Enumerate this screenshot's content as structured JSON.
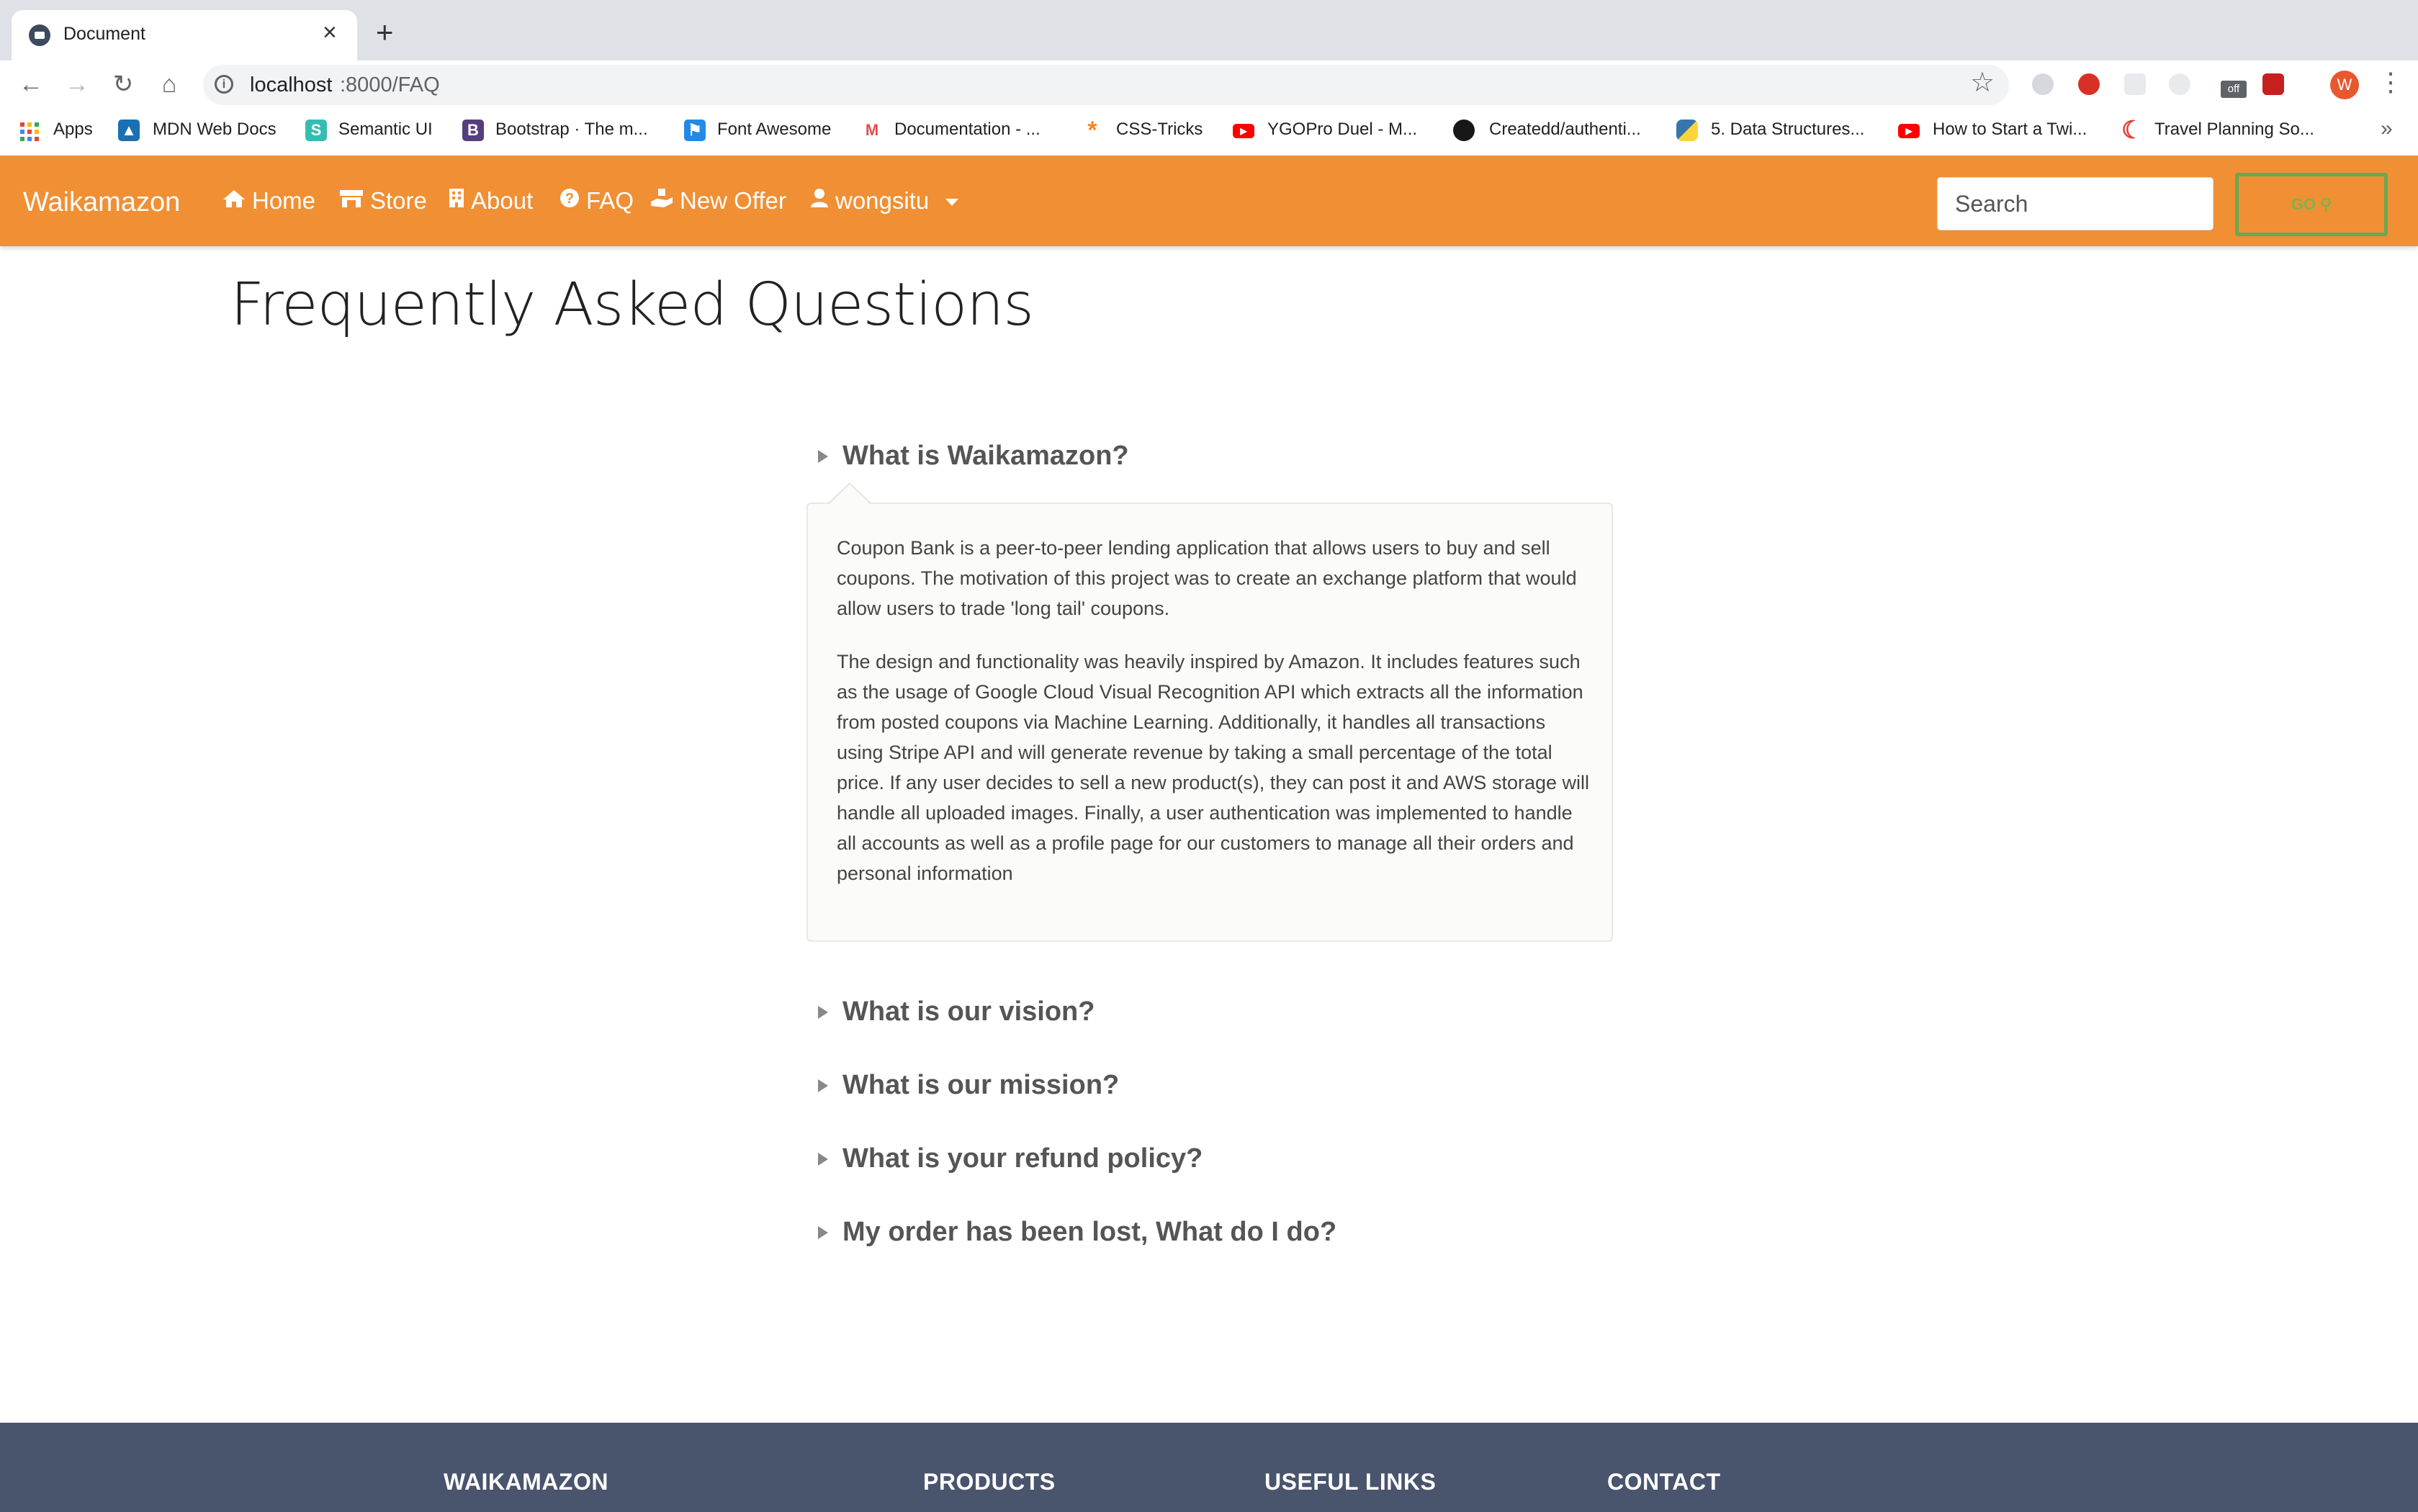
{
  "browser": {
    "tab": {
      "title": "Document"
    },
    "url": {
      "host": "localhost",
      "path": ":8000/FAQ"
    },
    "bookmarks": [
      {
        "label": "Apps"
      },
      {
        "label": "MDN Web Docs"
      },
      {
        "label": "Semantic UI"
      },
      {
        "label": "Bootstrap · The m..."
      },
      {
        "label": "Font Awesome"
      },
      {
        "label": "Documentation - ..."
      },
      {
        "label": "CSS-Tricks"
      },
      {
        "label": "YGOPro Duel - M..."
      },
      {
        "label": "Createdd/authenti..."
      },
      {
        "label": "5. Data Structures..."
      },
      {
        "label": "How to Start a Twi..."
      },
      {
        "label": "Travel Planning So..."
      }
    ],
    "profile_initial": "W",
    "more_bookmarks": "»"
  },
  "navbar": {
    "brand": "Waikamazon",
    "links": [
      {
        "label": "Home",
        "icon": "home-icon"
      },
      {
        "label": "Store",
        "icon": "store-icon"
      },
      {
        "label": "About",
        "icon": "building-icon"
      },
      {
        "label": "FAQ",
        "icon": "question-circle-icon"
      },
      {
        "label": "New Offer",
        "icon": "hand-holding-icon"
      },
      {
        "label": "wongsitu",
        "icon": "user-icon"
      }
    ],
    "search_placeholder": "Search",
    "go_label": "GO",
    "color": "#f18f34"
  },
  "main": {
    "title": "Frequently Asked Questions",
    "faq": [
      {
        "question": "What is Waikamazon?",
        "expanded": true,
        "answer": [
          "Coupon Bank is a peer-to-peer lending application that allows users to buy and sell coupons. The motivation of this project was to create an exchange platform that would allow users to trade 'long tail' coupons.",
          "The design and functionality was heavily inspired by Amazon. It includes features such as the usage of Google Cloud Visual Recognition API which extracts all the information from posted coupons via Machine Learning. Additionally, it handles all transactions using Stripe API and will generate revenue by taking a small percentage of the total price. If any user decides to sell a new product(s), they can post it and AWS storage will handle all uploaded images. Finally, a user authentication was implemented to handle all accounts as well as a profile page for our customers to manage all their orders and personal information"
        ]
      },
      {
        "question": "What is our vision?",
        "expanded": false
      },
      {
        "question": "What is our mission?",
        "expanded": false
      },
      {
        "question": "What is your refund policy?",
        "expanded": false
      },
      {
        "question": "My order has been lost, What do I do?",
        "expanded": false
      }
    ]
  },
  "footer": {
    "headings": [
      "WAIKAMAZON",
      "PRODUCTS",
      "USEFUL LINKS",
      "CONTACT"
    ],
    "color": "#49546d"
  }
}
